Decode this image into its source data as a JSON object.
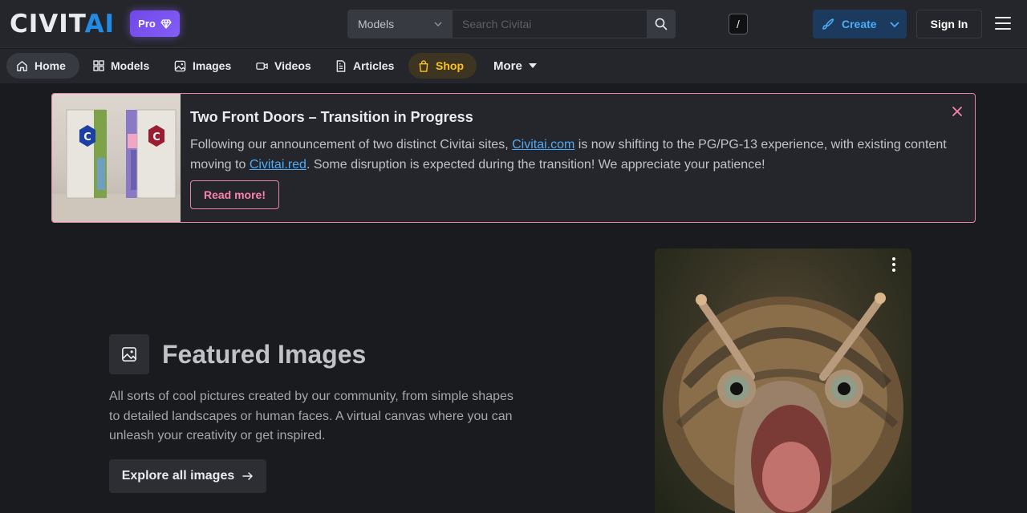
{
  "header": {
    "logo_main": "CIVIT",
    "logo_ai": "AI",
    "pro_label": "Pro",
    "search": {
      "selected_option": "Models",
      "placeholder": "Search Civitai",
      "shortcut": "/"
    },
    "create_label": "Create",
    "signin_label": "Sign In"
  },
  "nav": {
    "items": [
      {
        "label": "Home",
        "icon": "home-icon"
      },
      {
        "label": "Models",
        "icon": "grid-icon"
      },
      {
        "label": "Images",
        "icon": "image-icon"
      },
      {
        "label": "Videos",
        "icon": "video-icon"
      },
      {
        "label": "Articles",
        "icon": "article-icon"
      },
      {
        "label": "Shop",
        "icon": "shopping-bag-icon"
      }
    ],
    "more_label": "More"
  },
  "banner": {
    "title": "Two Front Doors – Transition in Progress",
    "text_1": "Following our announcement of two distinct Civitai sites, ",
    "link_1": "Civitai.com",
    "text_2": " is now shifting to the PG/PG-13 experience, with existing content moving to ",
    "link_2": "Civitai.red",
    "text_3": ". Some disruption is expected during the transition! We appreciate your patience!",
    "read_more": "Read more!",
    "image_door_logo": "C"
  },
  "featured": {
    "title": "Featured Images",
    "description": "All sorts of cool pictures created by our community, from simple shapes to detailed landscapes or human faces. A virtual canvas where you can unleash your creativity or get inspired.",
    "explore_label": "Explore all images"
  },
  "colors": {
    "background": "#1a1b1e",
    "header": "#25262b",
    "accent_blue": "#228be6",
    "pro_purple": "#7048e8",
    "banner_border": "#e685a8",
    "shop_yellow": "#fcc419"
  }
}
